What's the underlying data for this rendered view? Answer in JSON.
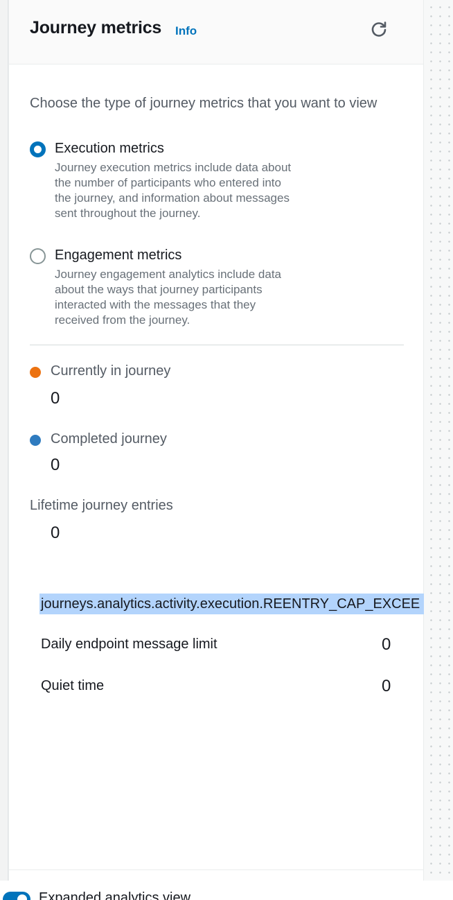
{
  "header": {
    "title": "Journey metrics",
    "info_link": "Info",
    "refresh_icon": "refresh-icon"
  },
  "metric_type": {
    "prompt": "Choose the type of journey metrics that you want to view",
    "options": [
      {
        "label": "Execution metrics",
        "description": "Journey execution metrics include data about the number of participants who entered into the journey, and information about messages sent throughout the journey.",
        "selected": true
      },
      {
        "label": "Engagement metrics",
        "description": "Journey engagement analytics include data about the ways that journey participants interacted with the messages that they received from the journey.",
        "selected": false
      }
    ]
  },
  "metrics": {
    "currently_in_journey": {
      "label": "Currently in journey",
      "value": "0",
      "color": "#ec7211"
    },
    "completed_journey": {
      "label": "Completed journey",
      "value": "0",
      "color": "#2e7bbf"
    },
    "lifetime_entries": {
      "label": "Lifetime journey entries",
      "value": "0"
    }
  },
  "execution_rows": {
    "reentry_cap_key": "journeys.analytics.activity.execution.REENTRY_CAP_EXCEE",
    "daily_limit": {
      "label": "Daily endpoint message limit",
      "value": "0"
    },
    "quiet_time": {
      "label": "Quiet time",
      "value": "0"
    }
  },
  "footer": {
    "toggle_label": "Expanded analytics view",
    "toggle_on": true
  },
  "colors": {
    "accent": "#0073bb",
    "selection_highlight": "#b3d4fc"
  }
}
